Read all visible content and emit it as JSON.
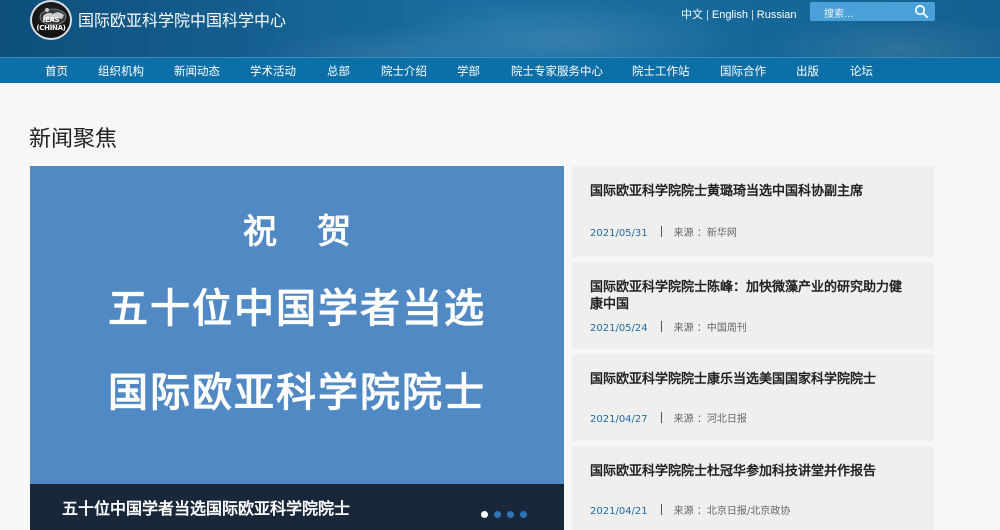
{
  "header": {
    "logo_text": "IEAS (CHINA)",
    "site_title": "国际欧亚科学院中国科学中心",
    "languages": [
      "中文",
      "English",
      "Russian"
    ],
    "search_placeholder": "搜索..."
  },
  "nav": {
    "items": [
      "首页",
      "组织机构",
      "新闻动态",
      "学术活动",
      "总部",
      "院士介绍",
      "学部",
      "院士专家服务中心",
      "院士工作站",
      "国际合作",
      "出版",
      "论坛"
    ]
  },
  "section": {
    "title": "新闻聚焦"
  },
  "slider": {
    "banner_lines": [
      "祝贺",
      "五十位中国学者当选",
      "国际欧亚科学院院士"
    ],
    "caption": "五十位中国学者当选国际欧亚科学院院士",
    "slide_count": 4,
    "active_index": 0
  },
  "news": [
    {
      "title": "国际欧亚科学院院士黄璐琦当选中国科协副主席",
      "date": "2021/05/31",
      "source": "来源 ：新华网"
    },
    {
      "title": "国际欧亚科学院院士陈峰：加快微藻产业的研究助力健康中国",
      "date": "2021/05/24",
      "source": "来源 ：中国周刊"
    },
    {
      "title": "国际欧亚科学院院士康乐当选美国国家科学院院士",
      "date": "2021/04/27",
      "source": "来源 ：河北日报"
    },
    {
      "title": "国际欧亚科学院院士杜冠华参加科技讲堂并作报告",
      "date": "2021/04/21",
      "source": "来源 ：北京日报/北京政协"
    }
  ],
  "colors": {
    "header": "#13608f",
    "nav": "#0d6fa8",
    "slider_bg": "#5089c4",
    "caption_bar": "#182739",
    "news_bg": "#efefed",
    "date_text": "#1f6aa5"
  }
}
